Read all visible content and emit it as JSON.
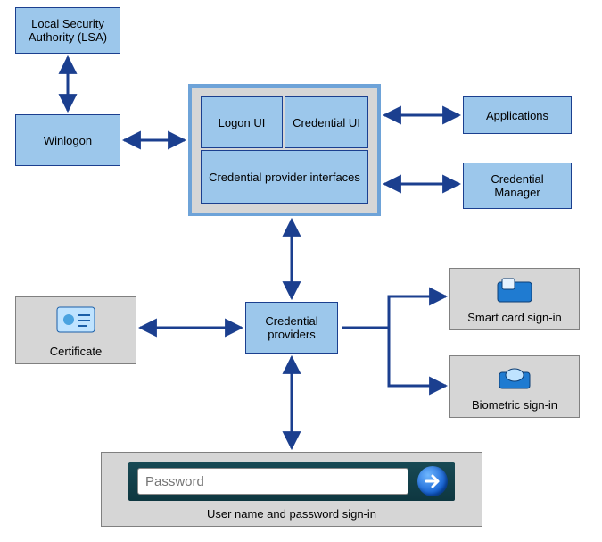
{
  "nodes": {
    "lsa": "Local Security Authority (LSA)",
    "winlogon": "Winlogon",
    "logon_ui": "Logon UI",
    "credential_ui": "Credential UI",
    "cred_prov_if": "Credential provider interfaces",
    "applications": "Applications",
    "cred_manager": "Credential Manager",
    "cred_providers": "Credential providers",
    "certificate": "Certificate",
    "smartcard": "Smart card sign-in",
    "biometric": "Biometric sign-in",
    "userpass_caption": "User name and password sign-in",
    "password_placeholder": "Password"
  },
  "icons": {
    "certificate": "certificate-icon",
    "smartcard": "smart-card-icon",
    "biometric": "biometric-reader-icon",
    "go": "arrow-right-circle-icon"
  },
  "arrows": [
    {
      "from": "lsa",
      "to": "winlogon",
      "dir": "both"
    },
    {
      "from": "winlogon",
      "to": "ui-frame",
      "dir": "both"
    },
    {
      "from": "ui-frame",
      "to": "applications",
      "dir": "both"
    },
    {
      "from": "ui-frame",
      "to": "cred_manager",
      "dir": "both"
    },
    {
      "from": "ui-frame",
      "to": "cred_providers",
      "dir": "both"
    },
    {
      "from": "cred_providers",
      "to": "certificate",
      "dir": "both"
    },
    {
      "from": "cred_providers",
      "to": "smartcard",
      "dir": "one"
    },
    {
      "from": "cred_providers",
      "to": "biometric",
      "dir": "one"
    },
    {
      "from": "cred_providers",
      "to": "userpass",
      "dir": "both"
    }
  ],
  "colors": {
    "node_fill": "#9cc7eb",
    "node_border": "#1b3f8f",
    "panel_fill": "#d6d6d6",
    "panel_border": "#808080",
    "arrow": "#1b3f8f"
  }
}
